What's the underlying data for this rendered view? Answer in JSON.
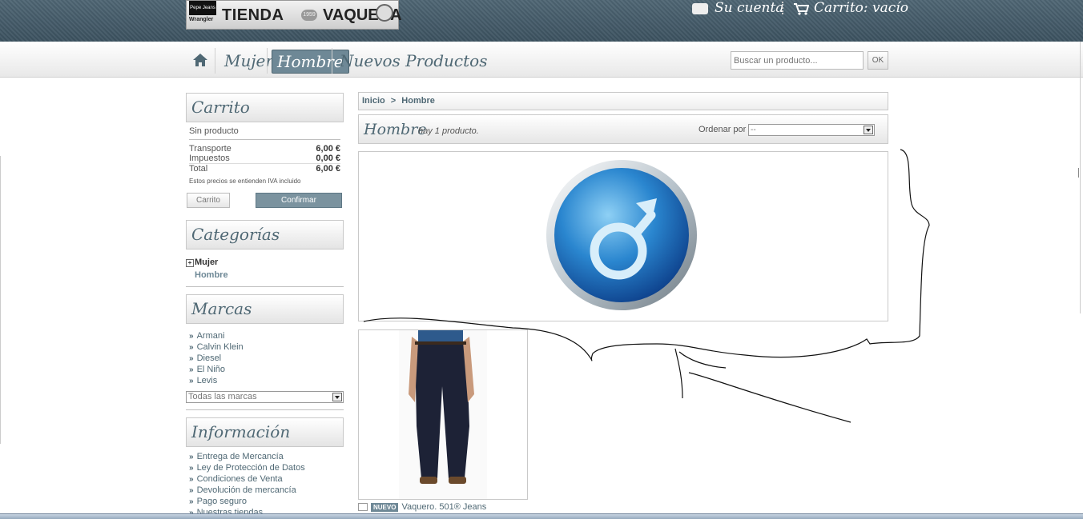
{
  "header": {
    "logo": {
      "brand_small": "Pepe Jeans",
      "wrangler": "Wrangler",
      "word1": "TIENDA",
      "badge": "1959",
      "word2": "VAQUERA"
    },
    "account_label": "Su cuenta",
    "cart_label": "Carrito: vacío"
  },
  "nav": {
    "items": [
      {
        "label": "Mujer"
      },
      {
        "label": "Hombre",
        "active": true
      },
      {
        "label": "Nuevos Productos"
      }
    ],
    "search": {
      "placeholder": "Buscar un producto...",
      "button": "OK"
    }
  },
  "sidebar": {
    "cart": {
      "title": "Carrito",
      "empty": "Sin producto",
      "rows": [
        {
          "label": "Transporte",
          "value": "6,00 €"
        },
        {
          "label": "Impuestos",
          "value": "0,00 €"
        },
        {
          "label": "Total",
          "value": "6,00 €"
        }
      ],
      "note": "Estos precios se entienden IVA incluido",
      "btn_cart": "Carrito",
      "btn_confirm": "Confirmar"
    },
    "categories": {
      "title": "Categorías",
      "items": [
        {
          "label": "Mujer",
          "expand": "+"
        },
        {
          "label": "Hombre"
        }
      ]
    },
    "brands": {
      "title": "Marcas",
      "items": [
        "Armani",
        "Calvin Klein",
        "Diesel",
        "El Niño",
        "Levis"
      ],
      "select": "Todas las marcas"
    },
    "info": {
      "title": "Información",
      "items": [
        "Entrega de Mercancía",
        "Ley de Protección de Datos",
        "Condiciones de Venta",
        "Devolución de mercancía",
        "Pago seguro",
        "Nuestras tiendas"
      ]
    }
  },
  "main": {
    "breadcrumb": {
      "home": "Inicio",
      "sep": ">",
      "current": "Hombre"
    },
    "category": {
      "title": "Hombre",
      "count": "hay 1 producto.",
      "sort_label": "Ordenar por",
      "sort_value": "--"
    },
    "product": {
      "badge": "NUEVO",
      "name": "Vaquero. 501® Jeans"
    }
  },
  "colors": {
    "accent": "#4f6874",
    "header_bg": "#445a68",
    "active_tab": "#6e8896"
  }
}
